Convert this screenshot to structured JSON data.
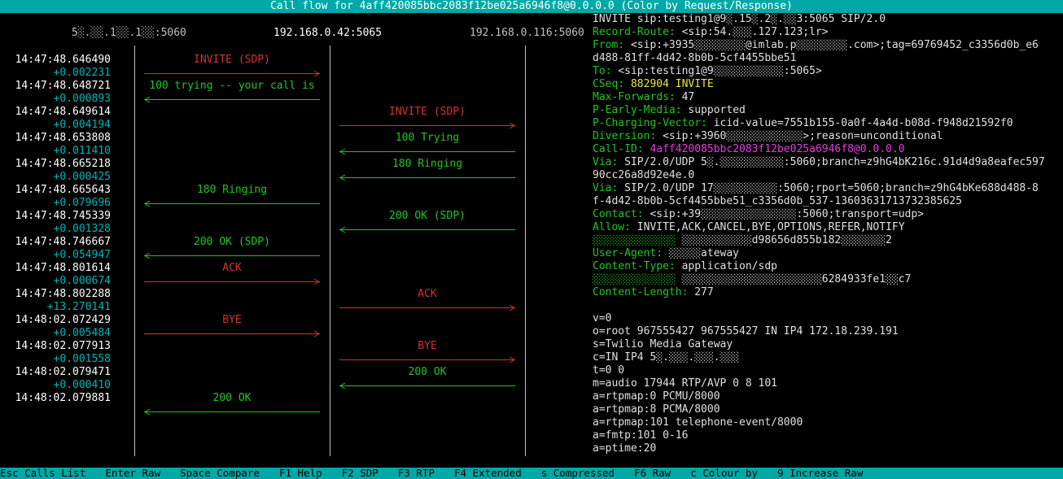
{
  "title": "Call flow for 4aff420085bbc2083f12be025a6946f8@0.0.0.0 (Color by Request/Response)",
  "hosts": [
    "5░.░░.1░░.1░░:5060",
    "192.168.0.42:5065",
    "192.168.0.116:5060"
  ],
  "timeline": [
    {
      "ts": "14:47:48.646490",
      "delta": "+0.002231"
    },
    {
      "ts": "14:47:48.648721",
      "delta": "+0.000893"
    },
    {
      "ts": "14:47:48.649614",
      "delta": "+0.004194"
    },
    {
      "ts": "14:47:48.653808",
      "delta": "+0.011410"
    },
    {
      "ts": "14:47:48.665218",
      "delta": "+0.000425"
    },
    {
      "ts": "14:47:48.665643",
      "delta": "+0.079696"
    },
    {
      "ts": "14:47:48.745339",
      "delta": "+0.001328"
    },
    {
      "ts": "14:47:48.746667",
      "delta": "+0.054947"
    },
    {
      "ts": "14:47:48.801614",
      "delta": "+0.000674"
    },
    {
      "ts": "14:47:48.802288",
      "delta": "+13.270141"
    },
    {
      "ts": "14:48:02.072429",
      "delta": "+0.005484"
    },
    {
      "ts": "14:48:02.077913",
      "delta": "+0.001558"
    },
    {
      "ts": "14:48:02.079471",
      "delta": "+0.000410"
    },
    {
      "ts": "14:48:02.079881",
      "delta": ""
    }
  ],
  "messages": [
    {
      "label": "INVITE (SDP)",
      "from": 0,
      "to": 1,
      "type": "request"
    },
    {
      "label": "100 trying -- your call is",
      "from": 1,
      "to": 0,
      "type": "response"
    },
    {
      "label": "INVITE (SDP)",
      "from": 1,
      "to": 2,
      "type": "request"
    },
    {
      "label": "100 Trying",
      "from": 2,
      "to": 1,
      "type": "response"
    },
    {
      "label": "180 Ringing",
      "from": 2,
      "to": 1,
      "type": "response"
    },
    {
      "label": "180 Ringing",
      "from": 1,
      "to": 0,
      "type": "response"
    },
    {
      "label": "200 OK (SDP)",
      "from": 2,
      "to": 1,
      "type": "response"
    },
    {
      "label": "200 OK (SDP)",
      "from": 1,
      "to": 0,
      "type": "response"
    },
    {
      "label": "ACK",
      "from": 0,
      "to": 1,
      "type": "request"
    },
    {
      "label": "ACK",
      "from": 1,
      "to": 2,
      "type": "request"
    },
    {
      "label": "BYE",
      "from": 0,
      "to": 1,
      "type": "request"
    },
    {
      "label": "BYE",
      "from": 1,
      "to": 2,
      "type": "request"
    },
    {
      "label": "200 OK",
      "from": 2,
      "to": 1,
      "type": "response"
    },
    {
      "label": "200 OK",
      "from": 1,
      "to": 0,
      "type": "response"
    }
  ],
  "raw_lines": [
    {
      "k": "INVITE sip:testing1@9░.15░.2░.░░3:5065 SIP/2.0",
      "v": "",
      "kc": "white"
    },
    {
      "k": "Record-Route:",
      "v": " <sip:54.░░░.127.123;lr>",
      "kc": "green"
    },
    {
      "k": "From:",
      "v": " <sip:+3935░░░░░░░░@imlab.p░░░░░░░░.com>;tag=69769452_c3356d0b_e6",
      "kc": "green"
    },
    {
      "k": "",
      "v": "d488-81ff-4d42-8b0b-5cf4455bbe51",
      "kc": "green"
    },
    {
      "k": "To:",
      "v": " <sip:testing1@9░░░░░░░░░░░:5065>",
      "kc": "green"
    },
    {
      "k": "CSeq:",
      "v": " 882904 INVITE",
      "kc": "green",
      "vc": "yellow"
    },
    {
      "k": "Max-Forwards:",
      "v": " 47",
      "kc": "green"
    },
    {
      "k": "P-Early-Media:",
      "v": " supported",
      "kc": "green"
    },
    {
      "k": "P-Charging-Vector:",
      "v": " icid-value=7551b155-0a0f-4a4d-b08d-f948d21592f0",
      "kc": "green"
    },
    {
      "k": "Diversion:",
      "v": " <sip:+3960░░░░░░░░░░░░>;reason=unconditional",
      "kc": "green"
    },
    {
      "k": "Call-ID:",
      "v": " 4aff420085bbc2083f12be025a6946f8@0.0.0.0",
      "kc": "green",
      "vc": "magenta"
    },
    {
      "k": "Via:",
      "v": " SIP/2.0/UDP 5░.░░░░░░░░░░:5060;branch=z9hG4bK216c.91d4d9a8eafec597",
      "kc": "green"
    },
    {
      "k": "",
      "v": "90cc26a8d92e4e.0",
      "kc": "green"
    },
    {
      "k": "Via:",
      "v": " SIP/2.0/UDP 17░░░░░░░░░░:5060;rport=5060;branch=z9hG4bKe688d488-8",
      "kc": "green"
    },
    {
      "k": "",
      "v": "f-4d42-8b0b-5cf4455bbe51_c3356d0b_537-13603631713732385625",
      "kc": "green"
    },
    {
      "k": "Contact:",
      "v": " <sip:+39░░░░░░░░░░░░░░░:5060;transport=udp>",
      "kc": "green"
    },
    {
      "k": "Allow:",
      "v": " INVITE,ACK,CANCEL,BYE,OPTIONS,REFER,NOTIFY",
      "kc": "green"
    },
    {
      "k": "░░░░░░░░░░░░░",
      "v": " ░░░░░░░░░░░d98656d855b182░░░░░░░2",
      "kc": "green"
    },
    {
      "k": "User-Agent:",
      "v": " ░░░░░ateway",
      "kc": "green"
    },
    {
      "k": "Content-Type:",
      "v": " application/sdp",
      "kc": "green"
    },
    {
      "k": "░░░░░░░░░░░░░",
      "v": " ░░░░░░░░░░░░░░░░░░░░░░6284933fe1░░c7",
      "kc": "green"
    },
    {
      "k": "Content-Length:",
      "v": " 277",
      "kc": "green"
    },
    {
      "k": "",
      "v": "",
      "kc": "white"
    },
    {
      "k": "v=0",
      "v": "",
      "kc": "white"
    },
    {
      "k": "o=root 967555427 967555427 IN IP4 172.18.239.191",
      "v": "",
      "kc": "white"
    },
    {
      "k": "s=Twilio Media Gateway",
      "v": "",
      "kc": "white"
    },
    {
      "k": "c=IN IP4 5░.░░░.░░░.░░░",
      "v": "",
      "kc": "white"
    },
    {
      "k": "t=0 0",
      "v": "",
      "kc": "white"
    },
    {
      "k": "m=audio 17944 RTP/AVP 0 8 101",
      "v": "",
      "kc": "white"
    },
    {
      "k": "a=rtpmap:0 PCMU/8000",
      "v": "",
      "kc": "white"
    },
    {
      "k": "a=rtpmap:8 PCMA/8000",
      "v": "",
      "kc": "white"
    },
    {
      "k": "a=rtpmap:101 telephone-event/8000",
      "v": "",
      "kc": "white"
    },
    {
      "k": "a=fmtp:101 0-16",
      "v": "",
      "kc": "white"
    },
    {
      "k": "a=ptime:20",
      "v": "",
      "kc": "white"
    }
  ],
  "statusbar": [
    "Esc Calls List",
    "Enter Raw",
    "Space Compare",
    "F1 Help",
    "F2 SDP",
    "F3 RTP",
    "F4 Extended",
    "s Compressed",
    "F6 Raw",
    "c Colour by",
    "9 Increase Raw"
  ],
  "colors": {
    "request": "#d23232",
    "response": "#22c422",
    "accent": "#00a8a8"
  }
}
